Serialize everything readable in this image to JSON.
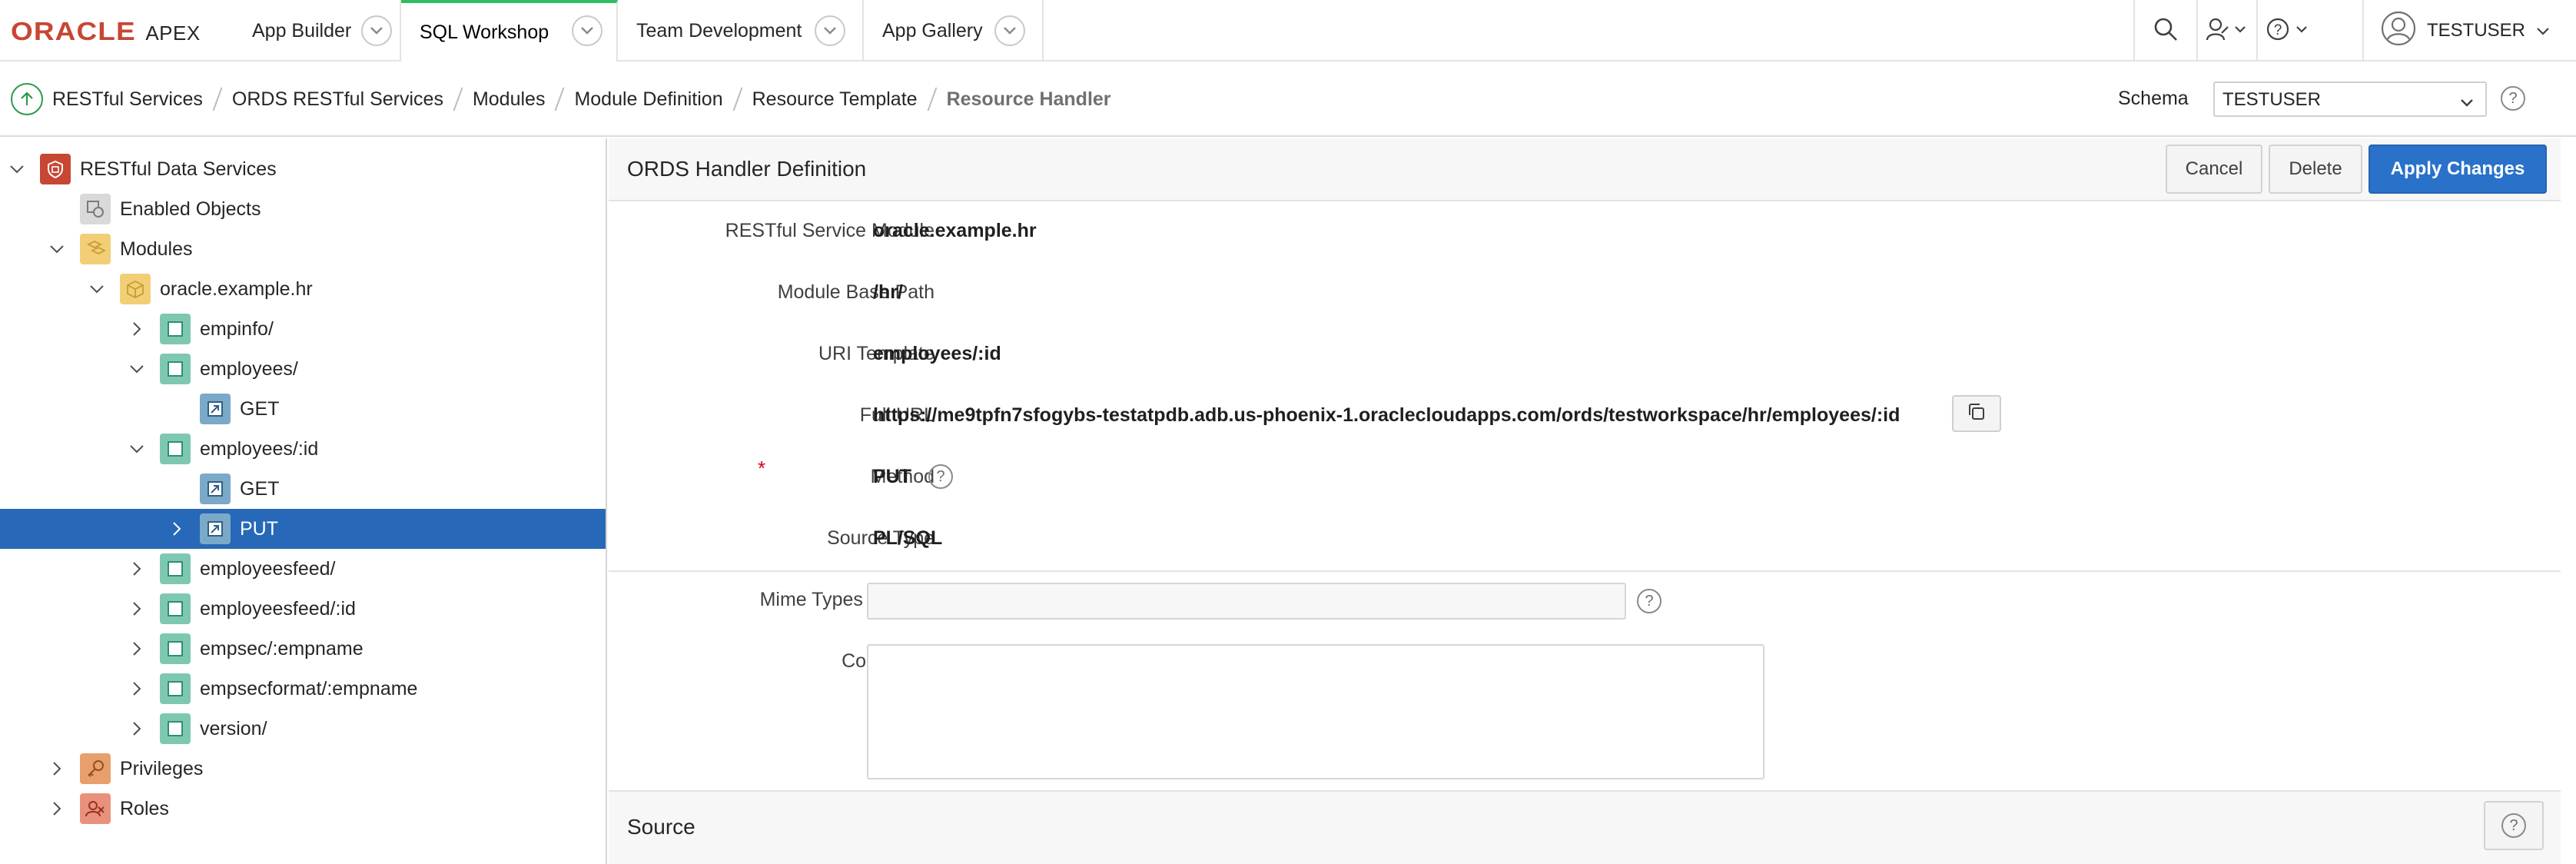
{
  "app": {
    "brand": "ORACLE",
    "product": "APEX"
  },
  "nav": {
    "tabs": [
      {
        "label": "App Builder"
      },
      {
        "label": "SQL Workshop"
      },
      {
        "label": "Team Development"
      },
      {
        "label": "App Gallery"
      }
    ],
    "user": "TESTUSER"
  },
  "breadcrumb": {
    "items": [
      "RESTful Services",
      "ORDS RESTful Services",
      "Modules",
      "Module Definition",
      "Resource Template",
      "Resource Handler"
    ]
  },
  "schema": {
    "label": "Schema",
    "value": "TESTUSER"
  },
  "tree": {
    "nodes": [
      {
        "label": "RESTful Data Services",
        "icon": "rest-services-icon"
      },
      {
        "label": "Enabled Objects",
        "icon": "enabled-objects-icon"
      },
      {
        "label": "Modules",
        "icon": "modules-icon"
      },
      {
        "label": "oracle.example.hr",
        "icon": "module-icon"
      },
      {
        "label": "empinfo/",
        "icon": "template-icon"
      },
      {
        "label": "employees/",
        "icon": "template-icon"
      },
      {
        "label": "GET",
        "icon": "handler-icon"
      },
      {
        "label": "employees/:id",
        "icon": "template-icon"
      },
      {
        "label": "GET",
        "icon": "handler-icon"
      },
      {
        "label": "PUT",
        "icon": "handler-icon"
      },
      {
        "label": "employeesfeed/",
        "icon": "template-icon"
      },
      {
        "label": "employeesfeed/:id",
        "icon": "template-icon"
      },
      {
        "label": "empsec/:empname",
        "icon": "template-icon"
      },
      {
        "label": "empsecformat/:empname",
        "icon": "template-icon"
      },
      {
        "label": "version/",
        "icon": "template-icon"
      },
      {
        "label": "Privileges",
        "icon": "privileges-icon"
      },
      {
        "label": "Roles",
        "icon": "roles-icon"
      }
    ],
    "selected_label": "PUT"
  },
  "handler": {
    "title": "ORDS Handler Definition",
    "buttons": {
      "cancel": "Cancel",
      "delete": "Delete",
      "apply": "Apply Changes"
    },
    "fields": {
      "module_label": "RESTful Service Module",
      "module_value": "oracle.example.hr",
      "base_path_label": "Module Base Path",
      "base_path_value": "/hr/",
      "uri_template_label": "URI Template",
      "uri_template_value": "employees/:id",
      "full_url_label": "Full URL",
      "full_url_value": "https://me9tpfn7sfogybs-testatpdb.adb.us-phoenix-1.oraclecloudapps.com/ords/testworkspace/hr/employees/:id",
      "method_label": "Method",
      "method_required": "*",
      "method_value": "PUT",
      "source_type_label": "Source Type",
      "source_type_value": "PL/SQL",
      "mime_label": "Mime Types Allowed",
      "mime_value": "",
      "comments_label": "Comments",
      "comments_value": ""
    },
    "help_glyph": "?"
  },
  "source": {
    "title": "Source"
  },
  "colors": {
    "accent": "#2a71c9",
    "selected": "#2768b8",
    "brand": "#c74634",
    "active_tab": "#2dbe60"
  }
}
